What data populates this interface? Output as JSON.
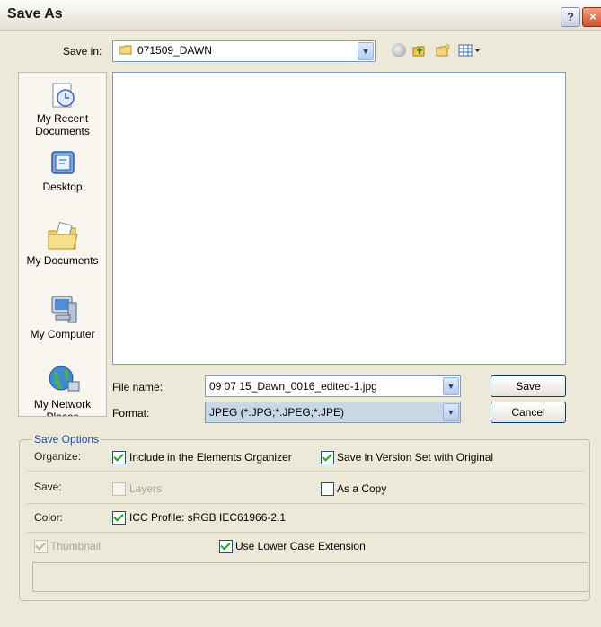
{
  "window": {
    "title": "Save As",
    "help_label": "?",
    "close_label": "×"
  },
  "save_in": {
    "label": "Save in:",
    "folder": "071509_DAWN"
  },
  "places": [
    {
      "label": "My Recent Documents",
      "icon": "recent-documents-icon"
    },
    {
      "label": "Desktop",
      "icon": "desktop-icon"
    },
    {
      "label": "My Documents",
      "icon": "my-documents-icon"
    },
    {
      "label": "My Computer",
      "icon": "my-computer-icon"
    },
    {
      "label": "My Network Places",
      "icon": "network-places-icon"
    }
  ],
  "file_name": {
    "label": "File name:",
    "value": "09 07 15_Dawn_0016_edited-1.jpg"
  },
  "format": {
    "label": "Format:",
    "value": "JPEG (*.JPG;*.JPEG;*.JPE)"
  },
  "buttons": {
    "save": "Save",
    "cancel": "Cancel"
  },
  "save_options": {
    "legend": "Save Options",
    "organize": {
      "label": "Organize:",
      "include": {
        "text": "Include in the Elements Organizer",
        "checked": true
      },
      "version_set": {
        "text": "Save in Version Set with Original",
        "checked": true
      }
    },
    "save": {
      "label": "Save:",
      "layers": {
        "text": "Layers",
        "checked": false,
        "disabled": true
      },
      "as_copy": {
        "text": "As a Copy",
        "checked": false
      }
    },
    "color": {
      "label": "Color:",
      "icc": {
        "text": "ICC Profile:  sRGB IEC61966-2.1",
        "checked": true
      }
    },
    "thumbnail": {
      "text": "Thumbnail",
      "checked": true,
      "disabled": true
    },
    "lowercase": {
      "text": "Use Lower Case Extension",
      "checked": true
    }
  }
}
